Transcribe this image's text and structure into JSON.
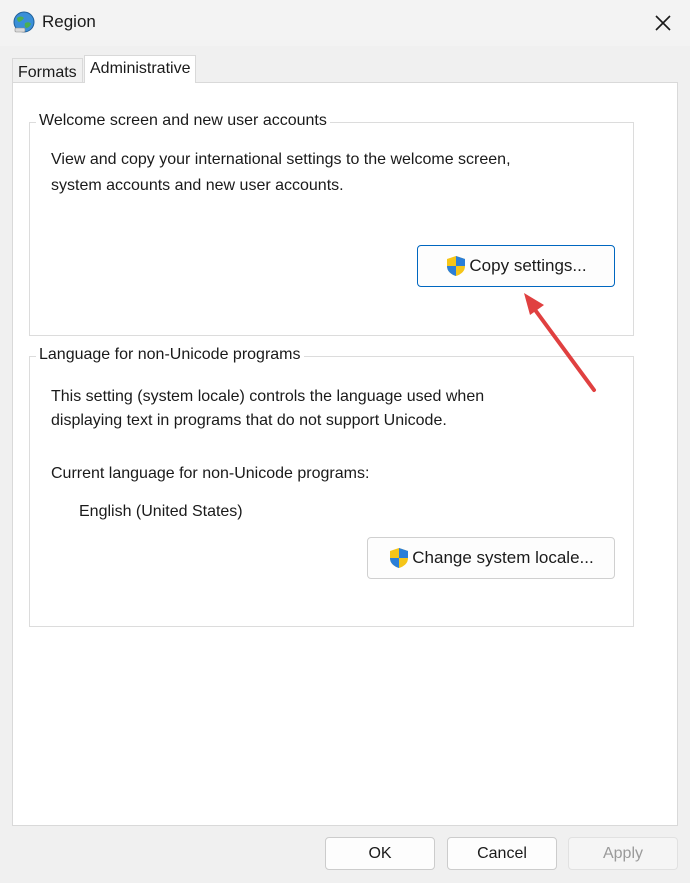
{
  "window": {
    "title": "Region"
  },
  "tabs": [
    {
      "label": "Formats",
      "selected": false
    },
    {
      "label": "Administrative",
      "selected": true
    }
  ],
  "welcome_group": {
    "legend": "Welcome screen and new user accounts",
    "description_line1": "View and copy your international settings to the welcome screen,",
    "description_line2": "system accounts and new user accounts.",
    "button_label": "Copy settings..."
  },
  "locale_group": {
    "legend": "Language for non-Unicode programs",
    "description_line1": "This setting (system locale) controls the language used when",
    "description_line2": "displaying text in programs that do not support Unicode.",
    "current_label": "Current language for non-Unicode programs:",
    "current_value": "English (United States)",
    "button_label": "Change system locale..."
  },
  "footer": {
    "ok_label": "OK",
    "cancel_label": "Cancel",
    "apply_label": "Apply"
  },
  "icons": {
    "title": "globe-icon",
    "close": "close-icon",
    "uac": "uac-shield-icon"
  },
  "colors": {
    "accent": "#0067c0",
    "annotation_arrow": "#e04040"
  }
}
